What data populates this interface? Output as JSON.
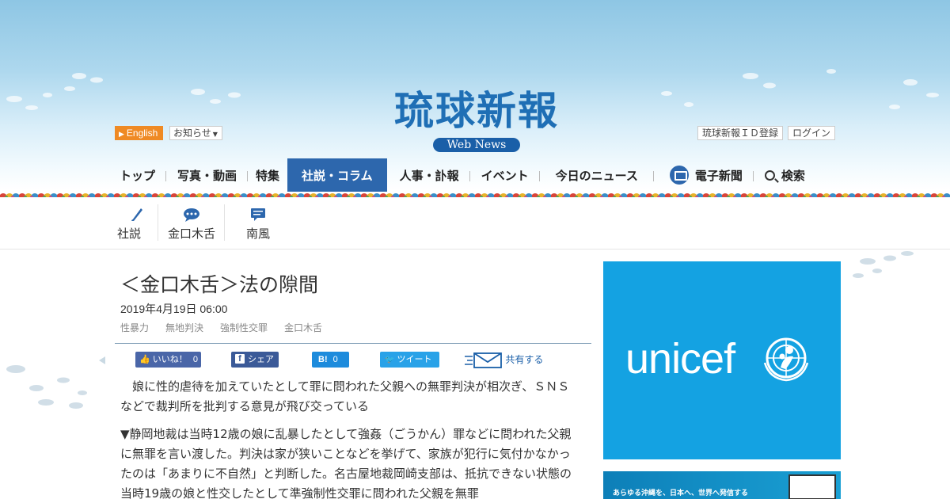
{
  "header": {
    "logo_title": "琉球新報",
    "logo_badge": "Web News",
    "english_label": "English",
    "notice_label": "お知らせ",
    "id_register_label": "琉球新報ＩＤ登録",
    "login_label": "ログイン"
  },
  "nav": {
    "items": [
      "トップ",
      "写真・動画",
      "特集",
      "社説・コラム",
      "人事・訃報",
      "イベント",
      "今日のニュース",
      "電子新聞",
      "検索"
    ],
    "active_index": 3
  },
  "subnav": {
    "items": [
      "社説",
      "金口木舌",
      "南風"
    ]
  },
  "article": {
    "title": "＜金口木舌＞法の隙間",
    "date": "2019年4月19日 06:00",
    "tags": [
      "性暴力",
      "無地判決",
      "強制性交罪",
      "金口木舌"
    ],
    "lead": "娘に性的虐待を加えていたとして罪に問われた父親への無罪判決が相次ぎ、ＳＮＳなどで裁判所を批判する意見が飛び交っている",
    "body": "▼静岡地裁は当時12歳の娘に乱暴したとして強姦（ごうかん）罪などに問われた父親に無罪を言い渡した。判決は家が狭いことなどを挙げて、家族が犯行に気付かなかったのは「あまりに不自然」と判断した。名古屋地裁岡崎支部は、抵抗できない状態の当時19歳の娘と性交したとして準強制性交罪に問われた父親を無罪"
  },
  "share": {
    "like_label": "いいね！",
    "like_count": "0",
    "fb_label": "シェア",
    "hb_label": "B!",
    "hb_count": "0",
    "tweet_label": "ツイート",
    "mail_label": "共有する"
  },
  "ads": {
    "unicef_text": "unicef",
    "banner2_text": "あらゆる沖縄を、日本へ、世界へ発信する"
  },
  "colors": {
    "brand_blue": "#1f6fb5",
    "nav_active": "#2d67ad",
    "english_orange": "#ef8a24",
    "unicef_blue": "#14a2e2"
  }
}
